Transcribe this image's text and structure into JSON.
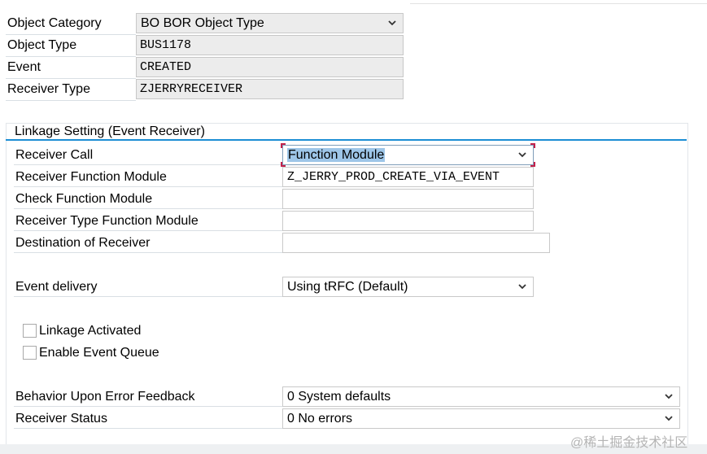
{
  "header_fields": [
    {
      "label": "Object Category",
      "value": "BO BOR Object Type"
    },
    {
      "label": "Object Type",
      "value": "BUS1178"
    },
    {
      "label": "Event",
      "value": "CREATED"
    },
    {
      "label": "Receiver Type",
      "value": "ZJERRYRECEIVER"
    }
  ],
  "linkage": {
    "title": "Linkage Setting (Event Receiver)",
    "receiver_call": {
      "label": "Receiver Call",
      "value": "Function Module"
    },
    "receiver_function_module": {
      "label": "Receiver Function Module",
      "value": "Z_JERRY_PROD_CREATE_VIA_EVENT"
    },
    "check_function_module": {
      "label": "Check Function Module",
      "value": ""
    },
    "receiver_type_function_module": {
      "label": "Receiver Type Function Module",
      "value": ""
    },
    "destination_of_receiver": {
      "label": "Destination of Receiver",
      "value": ""
    },
    "event_delivery": {
      "label": "Event delivery",
      "value": "Using tRFC (Default)"
    },
    "linkage_activated": {
      "label": "Linkage Activated",
      "checked": false
    },
    "enable_event_queue": {
      "label": "Enable Event Queue",
      "checked": false
    },
    "behavior_upon_error": {
      "label": "Behavior Upon Error Feedback",
      "value": "0 System defaults"
    },
    "receiver_status": {
      "label": "Receiver Status",
      "value": "0 No errors"
    }
  },
  "watermark": "@稀土掘金技术社区",
  "colors": {
    "accent": "#1c8ed4",
    "focus_corner": "#c3224b",
    "selection": "#9ec6e8",
    "readonly_bg": "#ececec"
  }
}
